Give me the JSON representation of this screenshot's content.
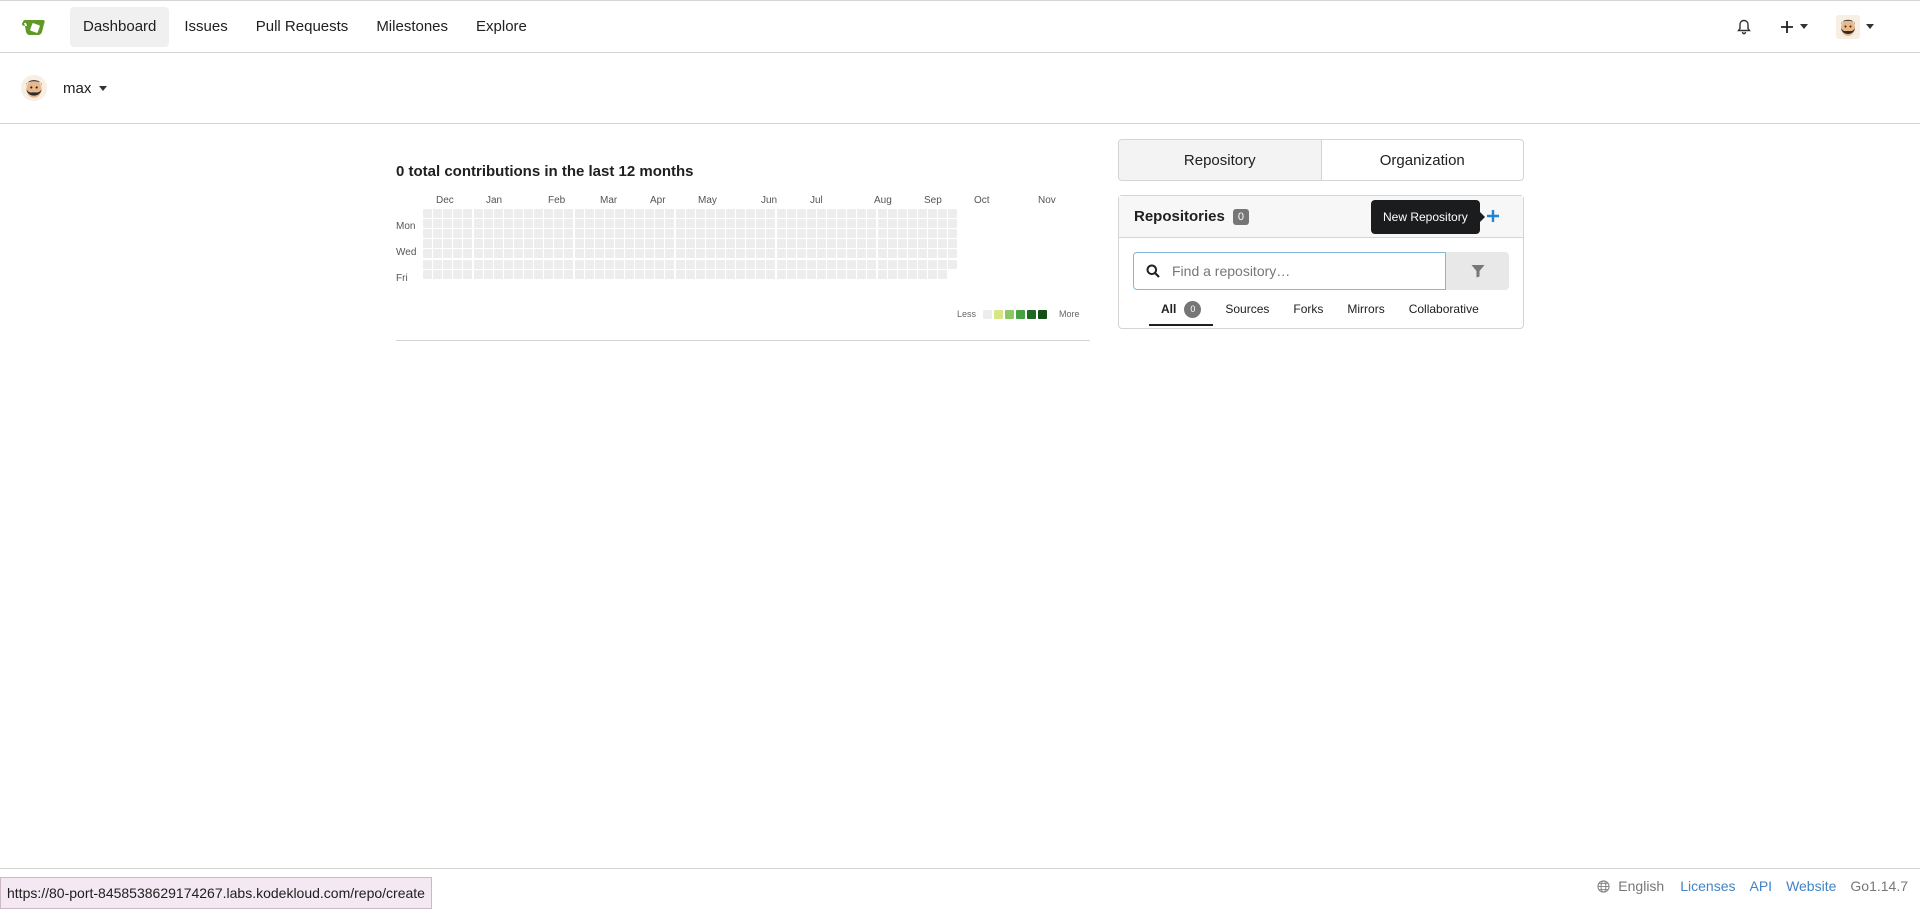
{
  "nav": {
    "items": [
      {
        "label": "Dashboard",
        "active": true
      },
      {
        "label": "Issues"
      },
      {
        "label": "Pull Requests"
      },
      {
        "label": "Milestones"
      },
      {
        "label": "Explore"
      }
    ],
    "icons": {
      "notifications": "bell-icon",
      "create": "plus-icon",
      "user_menu": "avatar"
    }
  },
  "context": {
    "username": "max"
  },
  "contributions": {
    "title": "0 total contributions in the last 12 months",
    "months": [
      "Dec",
      "Jan",
      "Feb",
      "Mar",
      "Apr",
      "May",
      "Jun",
      "Jul",
      "Aug",
      "Sep",
      "Oct",
      "Nov"
    ],
    "days": [
      "Mon",
      "Wed",
      "Fri"
    ],
    "legend": {
      "less": "Less",
      "more": "More",
      "colors": [
        "#ededed",
        "#d6e685",
        "#8cc665",
        "#44a340",
        "#1e6823",
        "#145015"
      ]
    },
    "empty_color": "#ededed"
  },
  "dashboard_tabs": [
    {
      "label": "Repository",
      "active": true
    },
    {
      "label": "Organization"
    }
  ],
  "repos": {
    "title": "Repositories",
    "count": "0",
    "tooltip": "New Repository",
    "search_placeholder": "Find a repository…",
    "filters": [
      {
        "label": "All",
        "badge": "0",
        "active": true
      },
      {
        "label": "Sources"
      },
      {
        "label": "Forks"
      },
      {
        "label": "Mirrors"
      },
      {
        "label": "Collaborative"
      }
    ]
  },
  "footer": {
    "language": "English",
    "links": [
      "Licenses",
      "API",
      "Website"
    ],
    "version": "Go1.14.7"
  },
  "status_url": "https://80-port-8458538629174267.labs.kodekloud.com/repo/create",
  "colors": {
    "accent": "#4183c4",
    "plus": "#2185d0",
    "logo_green": "#609926"
  }
}
